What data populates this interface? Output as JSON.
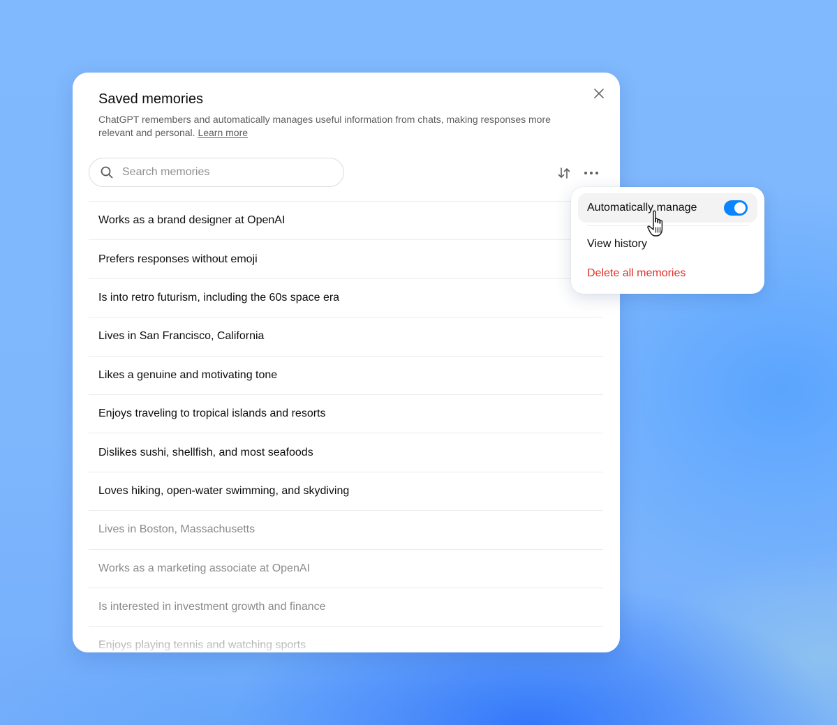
{
  "modal": {
    "title": "Saved memories",
    "description": "ChatGPT remembers and automatically manages useful information from chats, making responses more relevant and personal.",
    "learn_more": "Learn more"
  },
  "search": {
    "placeholder": "Search memories",
    "value": ""
  },
  "icons": {
    "close": "close-icon",
    "search": "search-icon",
    "sort": "sort-arrows-icon",
    "more": "more-horizontal-icon",
    "cursor": "hand-pointer-icon"
  },
  "memories": [
    {
      "text": "Works as a brand designer at OpenAI",
      "muted": false
    },
    {
      "text": "Prefers responses without emoji",
      "muted": false
    },
    {
      "text": "Is into retro futurism, including the 60s space era",
      "muted": false
    },
    {
      "text": "Lives in San Francisco, California",
      "muted": false
    },
    {
      "text": "Likes a genuine and motivating tone",
      "muted": false
    },
    {
      "text": "Enjoys traveling to tropical islands and resorts",
      "muted": false
    },
    {
      "text": "Dislikes sushi, shellfish, and most seafoods",
      "muted": false
    },
    {
      "text": "Loves hiking, open-water swimming, and skydiving",
      "muted": false
    },
    {
      "text": "Lives in Boston, Massachusetts",
      "muted": true
    },
    {
      "text": "Works as a marketing associate at OpenAI",
      "muted": true
    },
    {
      "text": "Is interested in investment growth and finance",
      "muted": true
    },
    {
      "text": "Enjoys playing tennis and watching sports",
      "muted": true
    }
  ],
  "dropdown": {
    "auto_manage_label": "Automatically manage",
    "auto_manage_enabled": true,
    "view_history_label": "View history",
    "delete_all_label": "Delete all memories"
  },
  "colors": {
    "accent": "#0a84ff",
    "danger": "#e02e2a",
    "background": "#7fb9fd"
  }
}
